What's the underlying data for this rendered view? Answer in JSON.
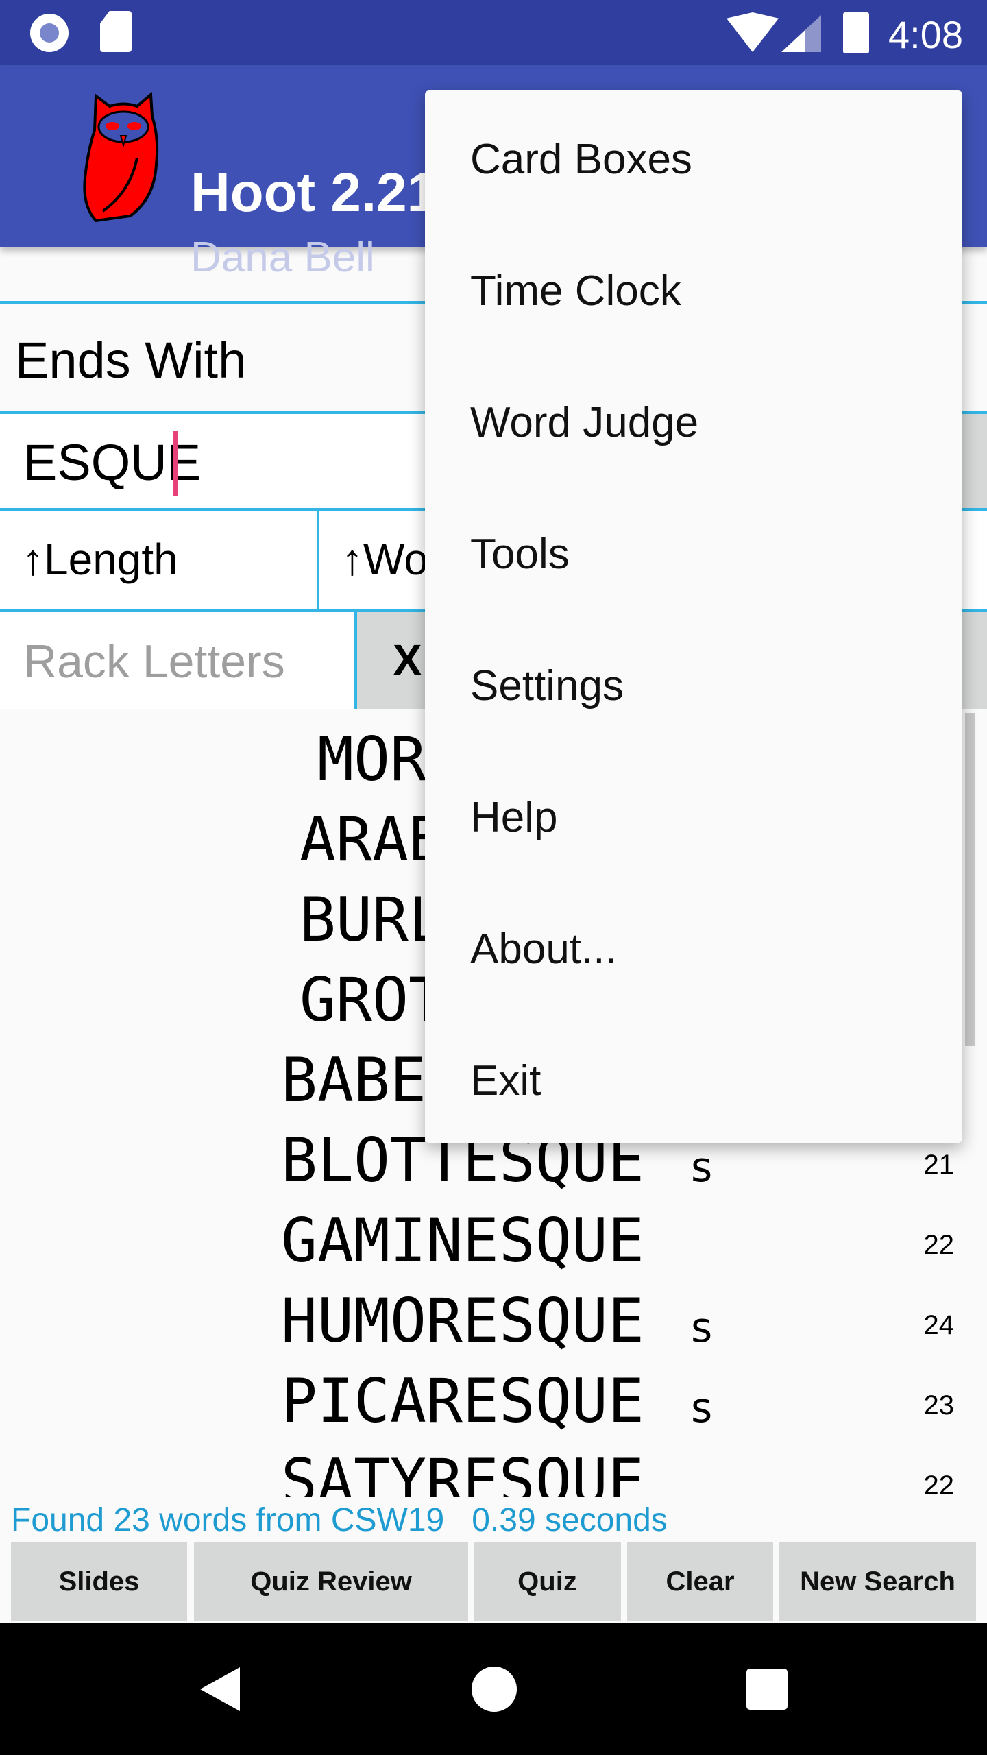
{
  "status_bar": {
    "time": "4:08",
    "icons": [
      "radio-icon",
      "sd-card-icon",
      "wifi-icon",
      "signal-icon",
      "battery-icon"
    ]
  },
  "app_bar": {
    "title": "Hoot 2.21",
    "subtitle": "Dana Bell",
    "logo": "owl-logo"
  },
  "search": {
    "type_label": "Ends With",
    "pattern_value": "ESQUE",
    "sort1_label": "↑Length",
    "sort2_label": "↑Wo",
    "rack_placeholder": "Rack Letters",
    "clear_rack_label": "X"
  },
  "results": [
    {
      "word": "MOR",
      "hook": "",
      "score": ""
    },
    {
      "word": "ARAB",
      "hook": "",
      "score": ""
    },
    {
      "word": "BURL",
      "hook": "",
      "score": ""
    },
    {
      "word": "GROT",
      "hook": "",
      "score": ""
    },
    {
      "word": "BABE",
      "hook": "",
      "score": ""
    },
    {
      "word": "BLOTTESQUE",
      "hook": "s",
      "score": "21"
    },
    {
      "word": "GAMINESQUE",
      "hook": "",
      "score": "22"
    },
    {
      "word": "HUMORESQUE",
      "hook": "s",
      "score": "24"
    },
    {
      "word": "PICARESQUE",
      "hook": "s",
      "score": "23"
    },
    {
      "word": "SATYRESQUE",
      "hook": "",
      "score": "22"
    }
  ],
  "found_text": "Found 23 words from CSW19   0.39 seconds",
  "buttons": {
    "slides": "Slides",
    "quiz_review": "Quiz Review",
    "quiz": "Quiz",
    "clear": "Clear",
    "new_search": "New Search"
  },
  "menu": {
    "items": [
      "Card Boxes",
      "Time Clock",
      "Word Judge",
      "Tools",
      "Settings",
      "Help",
      "About...",
      "Exit"
    ]
  },
  "colors": {
    "status_bar": "#303F9F",
    "app_bar": "#3F51B5",
    "accent_line": "#33B5E5",
    "cursor": "#E8407A",
    "found_text": "#1E9BD0",
    "button": "#D6D7D7"
  }
}
